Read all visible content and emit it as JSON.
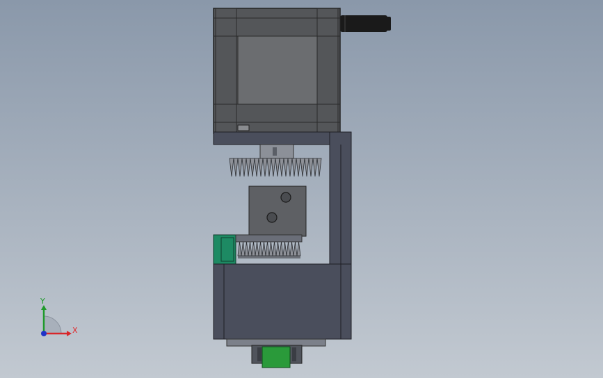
{
  "viewport": {
    "background_top": "#8a98aa",
    "background_bottom": "#c2c9d1"
  },
  "triad": {
    "x_label": "X",
    "y_label": "Y",
    "x_color": "#d8262a",
    "y_color": "#1f9a2b",
    "z_color": "#1f33c8"
  },
  "model": {
    "motor_color": "#545659",
    "motor_face_color": "#6b6d70",
    "bracket_color": "#4a4e5c",
    "gear_color": "#8e9198",
    "block_color": "#5e6064",
    "green_part_color": "#1d8a63",
    "coupling_color": "#2a9a3a",
    "cable_color": "#1a1a1a"
  }
}
